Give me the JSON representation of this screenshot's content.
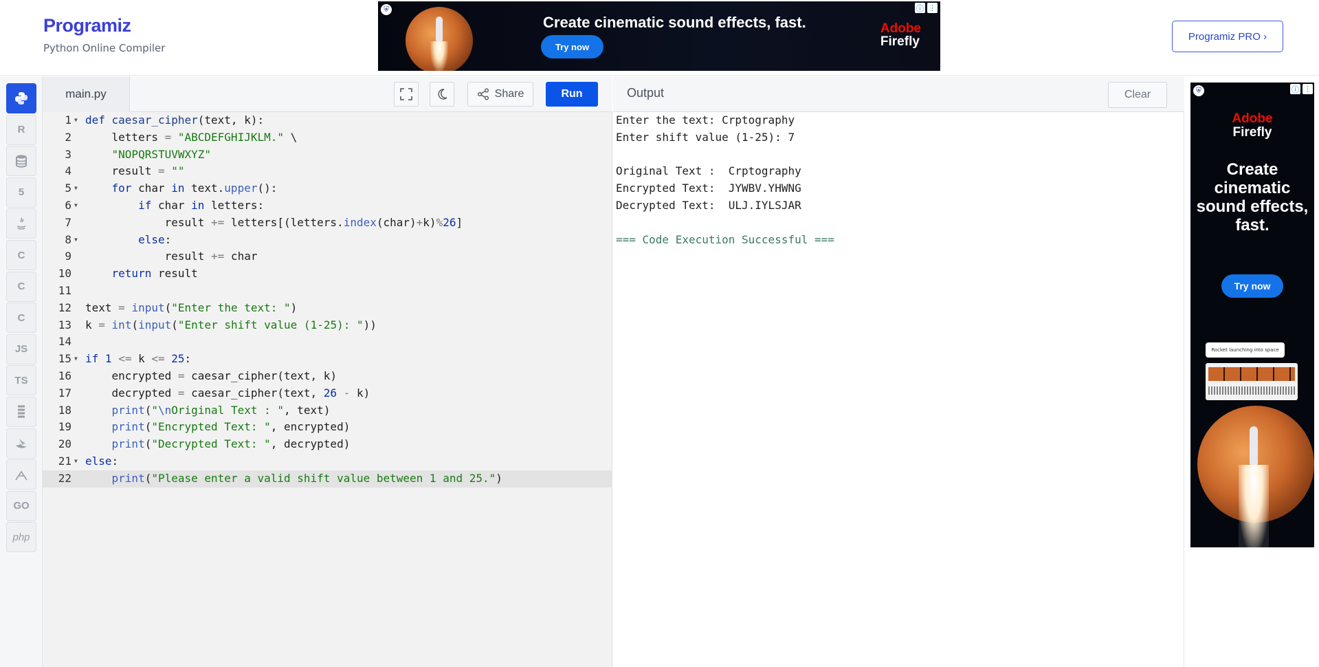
{
  "header": {
    "logo": "Programiz",
    "tagline": "Python Online Compiler",
    "pro_button": "Programiz PRO ›"
  },
  "ads": {
    "top": {
      "headline": "Create cinematic sound effects, fast.",
      "cta": "Try now",
      "brand_line1": "Adobe",
      "brand_line2": "Firefly",
      "info_icon": "ⓘ",
      "menu_icon": "⋮"
    },
    "side": {
      "brand_line1": "Adobe",
      "brand_line2": "Firefly",
      "headline": "Create cinematic sound effects, fast.",
      "cta": "Try now",
      "caption": "Rocket launching into space",
      "info_icon": "ⓘ",
      "menu_icon": "⋮"
    }
  },
  "sidebar": {
    "items": [
      {
        "name": "python",
        "label": "",
        "active": true
      },
      {
        "name": "r",
        "label": "R"
      },
      {
        "name": "sql",
        "label": ""
      },
      {
        "name": "html",
        "label": "5"
      },
      {
        "name": "java",
        "label": ""
      },
      {
        "name": "c",
        "label": "C"
      },
      {
        "name": "cpp",
        "label": "C"
      },
      {
        "name": "csharp",
        "label": "C"
      },
      {
        "name": "js",
        "label": "JS"
      },
      {
        "name": "ts",
        "label": "TS"
      },
      {
        "name": "rust",
        "label": ""
      },
      {
        "name": "swift",
        "label": ""
      },
      {
        "name": "kotlin",
        "label": ""
      },
      {
        "name": "go",
        "label": "GO"
      },
      {
        "name": "php",
        "label": "php"
      }
    ]
  },
  "editor": {
    "file_tab": "main.py",
    "share_label": "Share",
    "run_label": "Run",
    "active_line": 22
  },
  "output": {
    "title": "Output",
    "clear_label": "Clear",
    "lines": [
      "Enter the text: Crptography",
      "Enter shift value (1-25): 7",
      "",
      "Original Text :  Crptography",
      "Encrypted Text:  JYWBV.YHWNG",
      "Decrypted Text:  ULJ.IYLSJAR",
      "",
      "=== Code Execution Successful ==="
    ]
  },
  "code": [
    {
      "n": "1",
      "fold": true,
      "tokens": [
        [
          "kw",
          "def "
        ],
        [
          "fn",
          "caesar_cipher"
        ],
        [
          "",
          "(text, k):"
        ]
      ]
    },
    {
      "n": "2",
      "tokens": [
        [
          "",
          "    letters "
        ],
        [
          "op",
          "="
        ],
        [
          "str",
          " \"ABCDEFGHIJKLM.\""
        ],
        [
          "",
          " \\"
        ]
      ]
    },
    {
      "n": "3",
      "tokens": [
        [
          "str",
          "    \"NOPQRSTUVWXYZ\""
        ]
      ]
    },
    {
      "n": "4",
      "tokens": [
        [
          "",
          "    result "
        ],
        [
          "op",
          "="
        ],
        [
          "str",
          " \"\""
        ]
      ]
    },
    {
      "n": "5",
      "fold": true,
      "tokens": [
        [
          "kw",
          "    for"
        ],
        [
          "",
          " char "
        ],
        [
          "kw",
          "in"
        ],
        [
          "",
          " text."
        ],
        [
          "bi",
          "upper"
        ],
        [
          "",
          "():"
        ]
      ]
    },
    {
      "n": "6",
      "fold": true,
      "tokens": [
        [
          "kw",
          "        if"
        ],
        [
          "",
          " char "
        ],
        [
          "kw",
          "in"
        ],
        [
          "",
          " letters:"
        ]
      ]
    },
    {
      "n": "7",
      "tokens": [
        [
          "",
          "            result "
        ],
        [
          "op",
          "+="
        ],
        [
          "",
          " letters[(letters."
        ],
        [
          "bi",
          "index"
        ],
        [
          "",
          "(char)"
        ],
        [
          "op",
          "+"
        ],
        [
          "",
          "k)"
        ],
        [
          "op",
          "%"
        ],
        [
          "num",
          "26"
        ],
        [
          "",
          "]"
        ]
      ]
    },
    {
      "n": "8",
      "fold": true,
      "tokens": [
        [
          "kw",
          "        else"
        ],
        [
          "",
          ":"
        ]
      ]
    },
    {
      "n": "9",
      "tokens": [
        [
          "",
          "            result "
        ],
        [
          "op",
          "+="
        ],
        [
          "",
          " char"
        ]
      ]
    },
    {
      "n": "10",
      "tokens": [
        [
          "kw",
          "    return"
        ],
        [
          "",
          " result"
        ]
      ]
    },
    {
      "n": "11",
      "tokens": []
    },
    {
      "n": "12",
      "tokens": [
        [
          "",
          "text "
        ],
        [
          "op",
          "="
        ],
        [
          "",
          " "
        ],
        [
          "bi",
          "input"
        ],
        [
          "",
          "("
        ],
        [
          "str",
          "\"Enter the text: \""
        ],
        [
          "",
          ")"
        ]
      ]
    },
    {
      "n": "13",
      "tokens": [
        [
          "",
          "k "
        ],
        [
          "op",
          "="
        ],
        [
          "",
          " "
        ],
        [
          "bi",
          "int"
        ],
        [
          "",
          "("
        ],
        [
          "bi",
          "input"
        ],
        [
          "",
          "("
        ],
        [
          "str",
          "\"Enter shift value (1-25): \""
        ],
        [
          "",
          "))"
        ]
      ]
    },
    {
      "n": "14",
      "tokens": []
    },
    {
      "n": "15",
      "fold": true,
      "tokens": [
        [
          "kw",
          "if"
        ],
        [
          "",
          " "
        ],
        [
          "num",
          "1"
        ],
        [
          "",
          " "
        ],
        [
          "op",
          "<="
        ],
        [
          "",
          " k "
        ],
        [
          "op",
          "<="
        ],
        [
          "",
          " "
        ],
        [
          "num",
          "25"
        ],
        [
          "",
          ":"
        ]
      ]
    },
    {
      "n": "16",
      "tokens": [
        [
          "",
          "    encrypted "
        ],
        [
          "op",
          "="
        ],
        [
          "",
          " caesar_cipher(text, k)"
        ]
      ]
    },
    {
      "n": "17",
      "tokens": [
        [
          "",
          "    decrypted "
        ],
        [
          "op",
          "="
        ],
        [
          "",
          " caesar_cipher(text, "
        ],
        [
          "num",
          "26"
        ],
        [
          "",
          " "
        ],
        [
          "op",
          "-"
        ],
        [
          "",
          " k)"
        ]
      ]
    },
    {
      "n": "18",
      "tokens": [
        [
          "bi",
          "    print"
        ],
        [
          "",
          "("
        ],
        [
          "str",
          "\""
        ],
        [
          "bi",
          "\\n"
        ],
        [
          "str",
          "Original Text : \""
        ],
        [
          "",
          ", text)"
        ]
      ]
    },
    {
      "n": "19",
      "tokens": [
        [
          "bi",
          "    print"
        ],
        [
          "",
          "("
        ],
        [
          "str",
          "\"Encrypted Text: \""
        ],
        [
          "",
          ", encrypted)"
        ]
      ]
    },
    {
      "n": "20",
      "tokens": [
        [
          "bi",
          "    print"
        ],
        [
          "",
          "("
        ],
        [
          "str",
          "\"Decrypted Text: \""
        ],
        [
          "",
          ", decrypted)"
        ]
      ]
    },
    {
      "n": "21",
      "fold": true,
      "tokens": [
        [
          "kw",
          "else"
        ],
        [
          "",
          ":"
        ]
      ]
    },
    {
      "n": "22",
      "tokens": [
        [
          "bi",
          "    print"
        ],
        [
          "",
          "("
        ],
        [
          "str",
          "\"Please enter a valid shift value between 1 and 25.\""
        ],
        [
          "",
          ")"
        ]
      ]
    }
  ]
}
